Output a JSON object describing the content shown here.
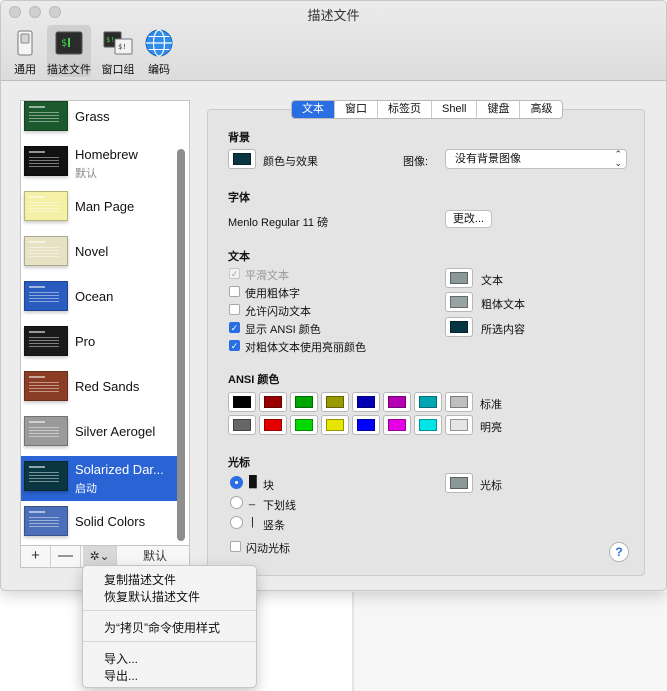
{
  "window": {
    "title": "描述文件"
  },
  "toolbar": {
    "items": [
      {
        "label": "通用"
      },
      {
        "label": "描述文件"
      },
      {
        "label": "窗口组"
      },
      {
        "label": "编码"
      }
    ]
  },
  "profiles": [
    {
      "name": "Grass",
      "sub": "",
      "color": "#1c5a2e"
    },
    {
      "name": "Homebrew",
      "sub": "默认",
      "color": "#111111"
    },
    {
      "name": "Man Page",
      "sub": "",
      "color": "#f4f0a6"
    },
    {
      "name": "Novel",
      "sub": "",
      "color": "#e8e2c4"
    },
    {
      "name": "Ocean",
      "sub": "",
      "color": "#2a5cbf"
    },
    {
      "name": "Pro",
      "sub": "",
      "color": "#1a1a1a"
    },
    {
      "name": "Red Sands",
      "sub": "",
      "color": "#8b3c24"
    },
    {
      "name": "Silver Aerogel",
      "sub": "",
      "color": "#9a9a9a"
    },
    {
      "name": "Solarized Dar...",
      "sub": "启动",
      "color": "#0a3641"
    },
    {
      "name": "Solid Colors",
      "sub": "",
      "color": "#4a6fb8"
    }
  ],
  "list_toolbar": {
    "add": "+",
    "remove": "—",
    "gear": "✲⌄",
    "default": "默认"
  },
  "tabs": [
    "文本",
    "窗口",
    "标签页",
    "Shell",
    "键盘",
    "高级"
  ],
  "background": {
    "section": "背景",
    "color_label": "颜色与效果",
    "swatch": "#0a3641",
    "image_label": "图像:",
    "image_value": "没有背景图像"
  },
  "font": {
    "section": "字体",
    "value": "Menlo Regular 11 磅",
    "change_button": "更改..."
  },
  "text": {
    "section": "文本",
    "options": [
      {
        "label": "平滑文本",
        "checked": true,
        "disabled": true
      },
      {
        "label": "使用粗体字",
        "checked": false,
        "disabled": false
      },
      {
        "label": "允许闪动文本",
        "checked": false,
        "disabled": false
      },
      {
        "label": "显示 ANSI 颜色",
        "checked": true,
        "disabled": false
      },
      {
        "label": "对粗体文本使用亮丽颜色",
        "checked": true,
        "disabled": false
      }
    ],
    "colors": [
      {
        "label": "文本",
        "color": "#8a9898"
      },
      {
        "label": "粗体文本",
        "color": "#98a4a4"
      },
      {
        "label": "所选内容",
        "color": "#073642"
      }
    ]
  },
  "ansi": {
    "section": "ANSI 颜色",
    "normal_label": "标准",
    "bright_label": "明亮",
    "normal": [
      "#000000",
      "#990000",
      "#00a600",
      "#999900",
      "#0000b2",
      "#b200b2",
      "#00a6b2",
      "#bfbfbf"
    ],
    "bright": [
      "#666666",
      "#e50000",
      "#00d900",
      "#e5e500",
      "#0000ff",
      "#e500e5",
      "#00e5e5",
      "#e5e5e5"
    ]
  },
  "cursor": {
    "section": "光标",
    "options": [
      {
        "label": "块",
        "glyph": "█",
        "selected": true
      },
      {
        "label": "下划线",
        "glyph": "_",
        "selected": false
      },
      {
        "label": "竖条",
        "glyph": "|",
        "selected": false
      }
    ],
    "blink_label": "闪动光标",
    "color_label": "光标",
    "color": "#8a9898"
  },
  "help": "?",
  "context_menu": {
    "items": [
      "复制描述文件",
      "恢复默认描述文件",
      "为“拷贝”命令使用样式",
      "导入...",
      "导出..."
    ]
  }
}
